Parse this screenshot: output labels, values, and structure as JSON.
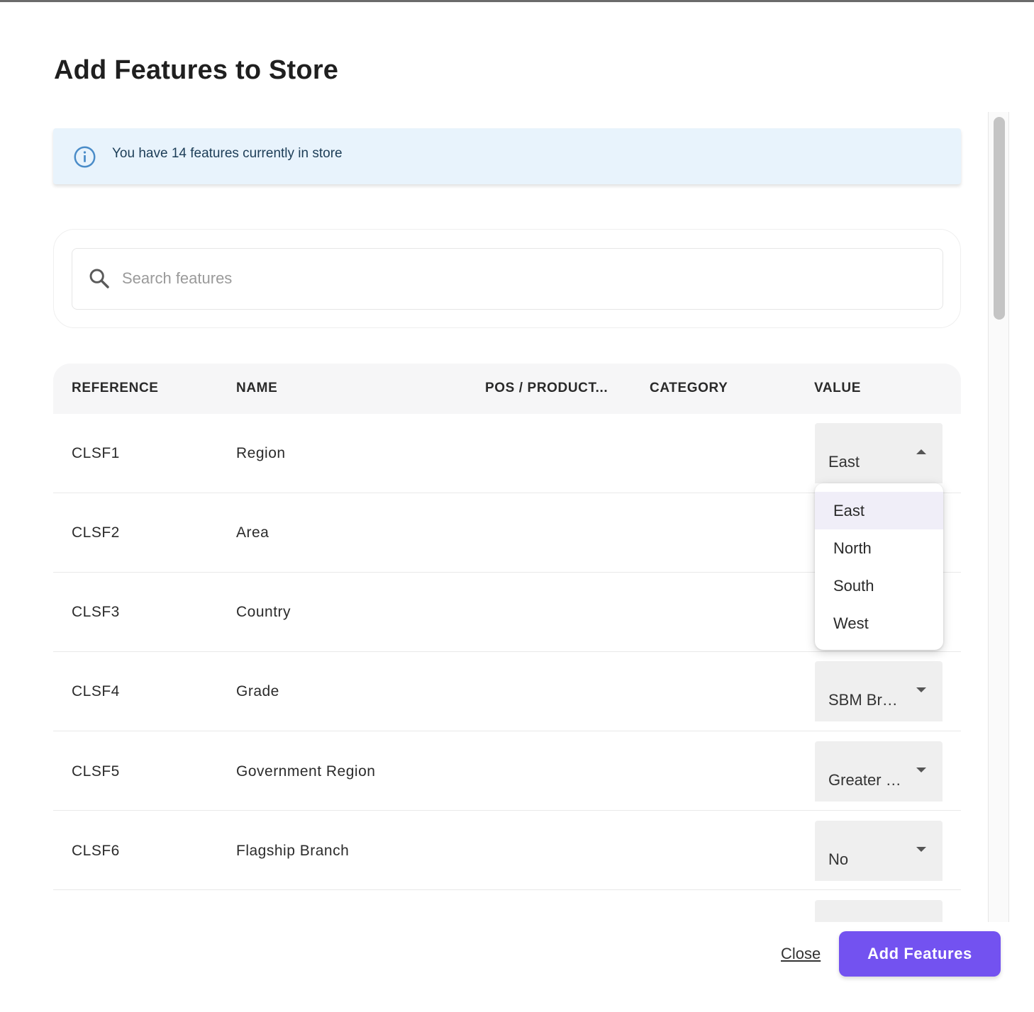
{
  "dialog": {
    "title": "Add Features to Store",
    "info_message": "You have 14 features currently in store",
    "search": {
      "placeholder": "Search features",
      "value": ""
    },
    "table": {
      "columns": [
        "REFERENCE",
        "NAME",
        "POS / PRODUCT...",
        "CATEGORY",
        "VALUE"
      ],
      "rows": [
        {
          "reference": "CLSF1",
          "name": "Region",
          "pos_product": "",
          "category": "",
          "value": "East"
        },
        {
          "reference": "CLSF2",
          "name": "Area",
          "pos_product": "",
          "category": "",
          "value": ""
        },
        {
          "reference": "CLSF3",
          "name": "Country",
          "pos_product": "",
          "category": "",
          "value": ""
        },
        {
          "reference": "CLSF4",
          "name": "Grade",
          "pos_product": "",
          "category": "",
          "value": "SBM Br…"
        },
        {
          "reference": "CLSF5",
          "name": "Government Region",
          "pos_product": "",
          "category": "",
          "value": "Greater …"
        },
        {
          "reference": "CLSF6",
          "name": "Flagship Branch",
          "pos_product": "",
          "category": "",
          "value": "No"
        }
      ]
    },
    "region_dropdown": {
      "open": true,
      "options": [
        "East",
        "North",
        "South",
        "West"
      ],
      "highlighted": "East"
    },
    "footer": {
      "close_label": "Close",
      "add_label": "Add Features"
    }
  },
  "colors": {
    "primary_button": "#7352f0",
    "info_background": "#e8f3fc",
    "info_icon": "#4a8cc8"
  }
}
